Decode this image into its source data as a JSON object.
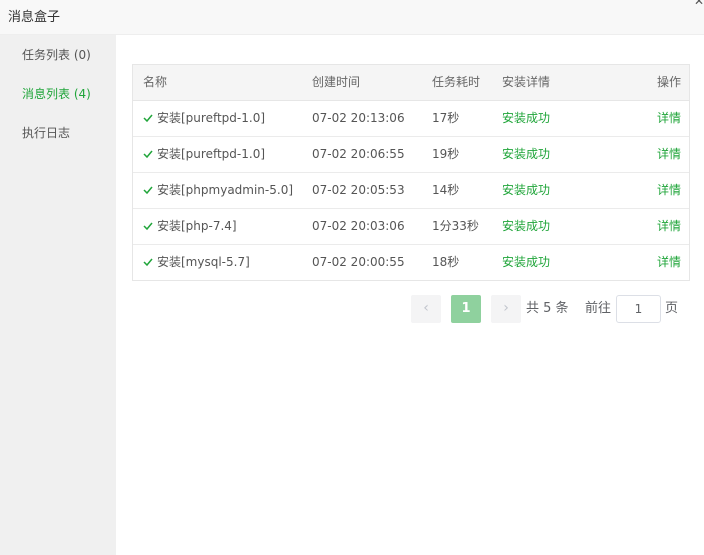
{
  "window": {
    "title": "消息盒子"
  },
  "sidebar": {
    "items": [
      {
        "label": "任务列表 (0)"
      },
      {
        "label": "消息列表 (4)"
      },
      {
        "label": "执行日志"
      }
    ]
  },
  "table": {
    "headers": {
      "name": "名称",
      "created": "创建时间",
      "duration": "任务耗时",
      "detail": "安装详情",
      "action": "操作"
    },
    "rows": [
      {
        "name": "安装[pureftpd-1.0]",
        "time": "07-02 20:13:06",
        "duration": "17秒",
        "status": "安装成功",
        "action": "详情"
      },
      {
        "name": "安装[pureftpd-1.0]",
        "time": "07-02 20:06:55",
        "duration": "19秒",
        "status": "安装成功",
        "action": "详情"
      },
      {
        "name": "安装[phpmyadmin-5.0]",
        "time": "07-02 20:05:53",
        "duration": "14秒",
        "status": "安装成功",
        "action": "详情"
      },
      {
        "name": "安装[php-7.4]",
        "time": "07-02 20:03:06",
        "duration": "1分33秒",
        "status": "安装成功",
        "action": "详情"
      },
      {
        "name": "安装[mysql-5.7]",
        "time": "07-02 20:00:55",
        "duration": "18秒",
        "status": "安装成功",
        "action": "详情"
      }
    ]
  },
  "pagination": {
    "prev": "‹",
    "current_page": "1",
    "next": "›",
    "total": "共 5 条",
    "goto_prefix": "前往",
    "goto_value": "1",
    "goto_suffix": "页"
  },
  "colors": {
    "accent": "#20a53a",
    "active_page": "#8fd19e",
    "sidebar_bg": "#f0f0f0"
  }
}
